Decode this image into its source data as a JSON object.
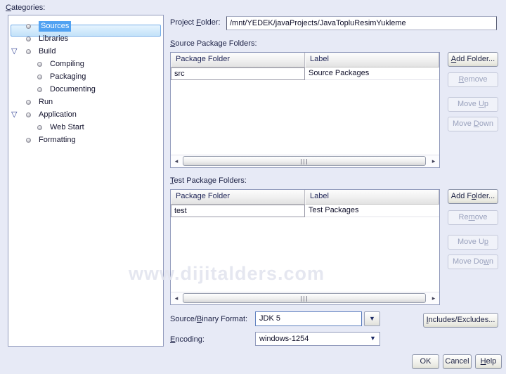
{
  "colors": {
    "dialog_background": "#e7eaf6",
    "selection_fill": "#51a2f2",
    "selection_row_border": "#77aee9",
    "focused_combo_border": "#5d7fbe",
    "header_text": "#23295a"
  },
  "icons": {
    "expander_open": "▽",
    "combo_arrow": "▼",
    "scroll_left_arrow": "◂",
    "scroll_right_arrow": "▸"
  },
  "categories": {
    "label": {
      "pre": "",
      "key": "C",
      "post": "ategories:"
    },
    "items": [
      {
        "label": "Sources",
        "selected": true
      },
      {
        "label": "Libraries"
      },
      {
        "label": "Build",
        "expanded": true
      },
      {
        "label": "Compiling"
      },
      {
        "label": "Packaging"
      },
      {
        "label": "Documenting"
      },
      {
        "label": "Run"
      },
      {
        "label": "Application",
        "expanded": true
      },
      {
        "label": "Web Start"
      },
      {
        "label": "Formatting"
      }
    ]
  },
  "project_folder": {
    "label": {
      "pre": "Project ",
      "key": "F",
      "post": "older:"
    },
    "value": "/mnt/YEDEK/javaProjects/JavaTopluResimYukleme"
  },
  "source_packages": {
    "label": {
      "pre": "",
      "key": "S",
      "post": "ource Package Folders:"
    },
    "columns": {
      "folder": "Package Folder",
      "label": "Label"
    },
    "row": {
      "folder": "src",
      "label": "Source Packages"
    },
    "buttons": {
      "add": {
        "pre": "",
        "key": "A",
        "post": "dd Folder..."
      },
      "remove": {
        "pre": "",
        "key": "R",
        "post": "emove"
      },
      "move_up": {
        "pre": "Move ",
        "key": "U",
        "post": "p"
      },
      "move_down": {
        "pre": "Move ",
        "key": "D",
        "post": "own"
      }
    }
  },
  "test_packages": {
    "label": {
      "pre": "",
      "key": "T",
      "post": "est Package Folders:"
    },
    "columns": {
      "folder": "Package Folder",
      "label": "Label"
    },
    "row": {
      "folder": "test",
      "label": "Test Packages"
    },
    "buttons": {
      "add": {
        "pre": "Add F",
        "key": "o",
        "post": "lder..."
      },
      "remove": {
        "pre": "Re",
        "key": "m",
        "post": "ove"
      },
      "move_up": {
        "pre": "Move U",
        "key": "p",
        "post": ""
      },
      "move_down": {
        "pre": "Move Do",
        "key": "w",
        "post": "n"
      }
    }
  },
  "format": {
    "label": {
      "pre": "Source/",
      "key": "B",
      "post": "inary Format:"
    },
    "value": "JDK 5"
  },
  "encoding": {
    "label": {
      "pre": "",
      "key": "E",
      "post": "ncoding:"
    },
    "value": "windows-1254"
  },
  "includes_excludes": {
    "pre": "",
    "key": "I",
    "post": "ncludes/Excludes..."
  },
  "dialog_buttons": {
    "ok": "OK",
    "cancel": "Cancel",
    "help": {
      "pre": "",
      "key": "H",
      "post": "elp"
    }
  },
  "watermark": "www.dijitalders.com"
}
